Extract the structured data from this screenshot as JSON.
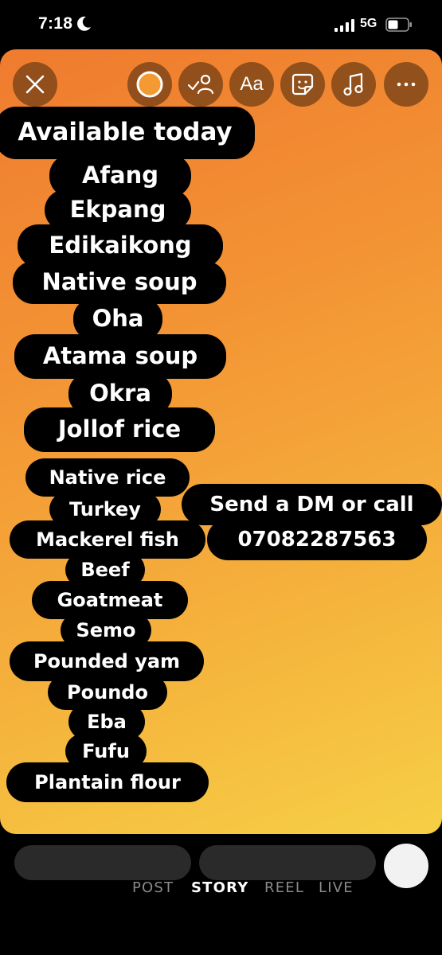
{
  "status_bar": {
    "time": "7:18",
    "network": "5G",
    "icons": [
      "moon-icon",
      "signal-icon",
      "battery-icon"
    ]
  },
  "toolbar": {
    "close": "close-icon",
    "color": "color-picker-icon",
    "mention": "mention-icon",
    "text_label": "Aa",
    "sticker": "sticker-icon",
    "music": "music-icon",
    "more": "more-icon"
  },
  "story": {
    "heading": "Available today",
    "soups": [
      "Afang",
      "Ekpang",
      "Edikaikong",
      "Native soup",
      "Oha",
      "Atama soup",
      "Okra",
      "Jollof rice"
    ],
    "menu": [
      "Native rice",
      "Turkey",
      "Mackerel fish",
      "Beef",
      "Goatmeat",
      "Semo",
      "Pounded yam",
      "Poundo",
      "Eba",
      "Fufu",
      "Plantain flour"
    ],
    "contact_line1": "Send a DM or call",
    "contact_line2": "07082287563"
  },
  "modes": {
    "post": "POST",
    "story": "STORY",
    "reel": "REEL",
    "live": "LIVE",
    "active": "STORY"
  },
  "colors": {
    "gradient_start": "#ef7b2f",
    "gradient_end": "#f6cf45",
    "pill": "#000000"
  }
}
